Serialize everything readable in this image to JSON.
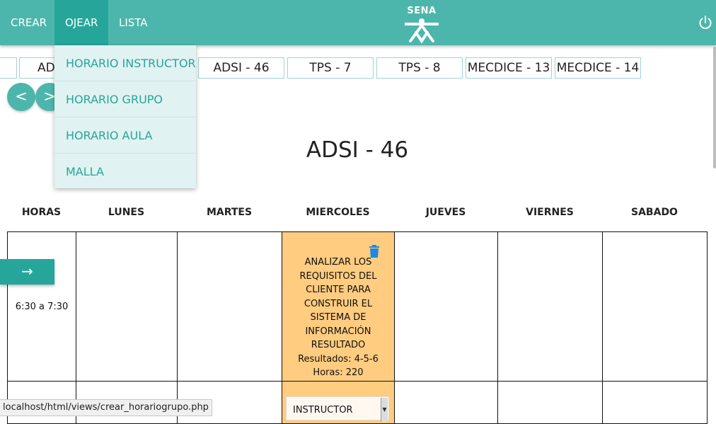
{
  "nav": {
    "items": [
      "CREAR",
      "OJEAR",
      "LISTA"
    ],
    "logo_text": "SENA",
    "colors": {
      "primary": "#4db6ac",
      "active": "#26a69a",
      "dropdown_bg": "#e0f2f1",
      "class_cell": "#ffcc80"
    }
  },
  "dropdown": {
    "items": [
      "HORARIO INSTRUCTOR",
      "HORARIO GRUPO",
      "HORARIO AULA",
      "MALLA"
    ]
  },
  "group_tabs": [
    "AD",
    "ADSI - 46",
    "TPS - 7",
    "TPS - 8",
    "MECDICE - 13",
    "MECDICE - 14"
  ],
  "pager": {
    "prev": "<",
    "next": ">"
  },
  "title": "ADSI - 46",
  "schedule": {
    "headers": [
      "HORAS",
      "LUNES",
      "MARTES",
      "MIERCOLES",
      "JUEVES",
      "VIERNES",
      "SABADO"
    ],
    "row1_hour": "6:30 a 7:30",
    "class": {
      "name": "ANALIZAR LOS REQUISITOS DEL CLIENTE PARA CONSTRUIR EL SISTEMA DE INFORMACIÓN RESULTADO",
      "results": "Resultados: 4-5-6",
      "hours": "Horas: 220"
    },
    "instructor_select": "INSTRUCTOR"
  },
  "arrow_button": "→",
  "status_url": "localhost/html/views/crear_horariogrupo.php",
  "icons": {
    "power": "power-icon",
    "trash": "trash-icon"
  }
}
